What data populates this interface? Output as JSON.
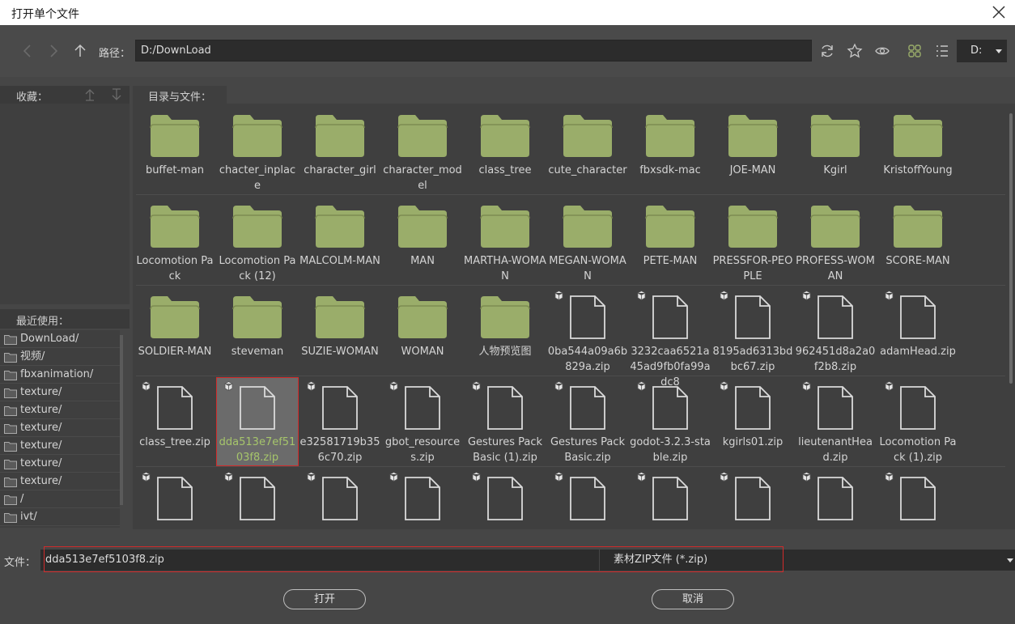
{
  "window": {
    "title": "打开单个文件"
  },
  "toolbar": {
    "path_label": "路径：",
    "path_value": "D:/DownLoad",
    "drive": "D:"
  },
  "sidebar": {
    "favorites_label": "收藏：",
    "recent_label": "最近使用：",
    "recent": [
      "DownLoad/",
      "视频/",
      "fbxanimation/",
      "texture/",
      "texture/",
      "texture/",
      "texture/",
      "texture/",
      "texture/",
      "/",
      "ivt/"
    ]
  },
  "files_tab": "目录与文件：",
  "items": [
    {
      "name": "buffet-man",
      "type": "folder"
    },
    {
      "name": "chacter_inplace",
      "type": "folder"
    },
    {
      "name": "character_girl",
      "type": "folder"
    },
    {
      "name": "character_model",
      "type": "folder"
    },
    {
      "name": "class_tree",
      "type": "folder"
    },
    {
      "name": "cute_character",
      "type": "folder"
    },
    {
      "name": "fbxsdk-mac",
      "type": "folder"
    },
    {
      "name": "JOE-MAN",
      "type": "folder"
    },
    {
      "name": "Kgirl",
      "type": "folder"
    },
    {
      "name": "KristoffYoung",
      "type": "folder"
    },
    {
      "name": "Locomotion Pack",
      "type": "folder"
    },
    {
      "name": "Locomotion Pack (12)",
      "type": "folder"
    },
    {
      "name": "MALCOLM-MAN",
      "type": "folder"
    },
    {
      "name": "MAN",
      "type": "folder"
    },
    {
      "name": "MARTHA-WOMAN",
      "type": "folder"
    },
    {
      "name": "MEGAN-WOMAN",
      "type": "folder"
    },
    {
      "name": "PETE-MAN",
      "type": "folder"
    },
    {
      "name": "PRESSFOR-PEOPLE",
      "type": "folder"
    },
    {
      "name": "PROFESS-WOMAN",
      "type": "folder"
    },
    {
      "name": "SCORE-MAN",
      "type": "folder"
    },
    {
      "name": "SOLDIER-MAN",
      "type": "folder"
    },
    {
      "name": "steveman",
      "type": "folder"
    },
    {
      "name": "SUZIE-WOMAN",
      "type": "folder"
    },
    {
      "name": "WOMAN",
      "type": "folder"
    },
    {
      "name": "人物预览图",
      "type": "folder"
    },
    {
      "name": "0ba544a09a6b829a.zip",
      "type": "zip"
    },
    {
      "name": "3232caa6521a45ad9fb0fa99adc8",
      "type": "zip"
    },
    {
      "name": "8195ad6313bdbc67.zip",
      "type": "zip"
    },
    {
      "name": "962451d8a2a0f2b8.zip",
      "type": "zip"
    },
    {
      "name": "adamHead.zip",
      "type": "zip"
    },
    {
      "name": "class_tree.zip",
      "type": "zip"
    },
    {
      "name": "dda513e7ef5103f8.zip",
      "type": "zip",
      "selected": true
    },
    {
      "name": "e32581719b356c70.zip",
      "type": "zip"
    },
    {
      "name": "gbot_resources.zip",
      "type": "zip"
    },
    {
      "name": "Gestures Pack Basic (1).zip",
      "type": "zip"
    },
    {
      "name": "Gestures Pack Basic.zip",
      "type": "zip"
    },
    {
      "name": "godot-3.2.3-stable.zip",
      "type": "zip"
    },
    {
      "name": "kgirls01.zip",
      "type": "zip"
    },
    {
      "name": "lieutenantHead.zip",
      "type": "zip"
    },
    {
      "name": "Locomotion Pack (1).zip",
      "type": "zip"
    },
    {
      "name": "",
      "type": "zip"
    },
    {
      "name": "",
      "type": "zip"
    },
    {
      "name": "",
      "type": "zip"
    },
    {
      "name": "",
      "type": "zip"
    },
    {
      "name": "",
      "type": "zip"
    },
    {
      "name": "",
      "type": "zip"
    },
    {
      "name": "",
      "type": "zip"
    },
    {
      "name": "",
      "type": "zip"
    },
    {
      "name": "",
      "type": "zip"
    },
    {
      "name": "",
      "type": "zip"
    }
  ],
  "footer": {
    "file_label": "文件：",
    "file_value": "dda513e7ef5103f8.zip",
    "filter": "素材ZIP文件 (*.zip)",
    "open": "打开",
    "cancel": "取消"
  },
  "colors": {
    "folder": "#9aad6a",
    "selected_text": "#a6c56b",
    "highlight": "#d12b2b"
  }
}
